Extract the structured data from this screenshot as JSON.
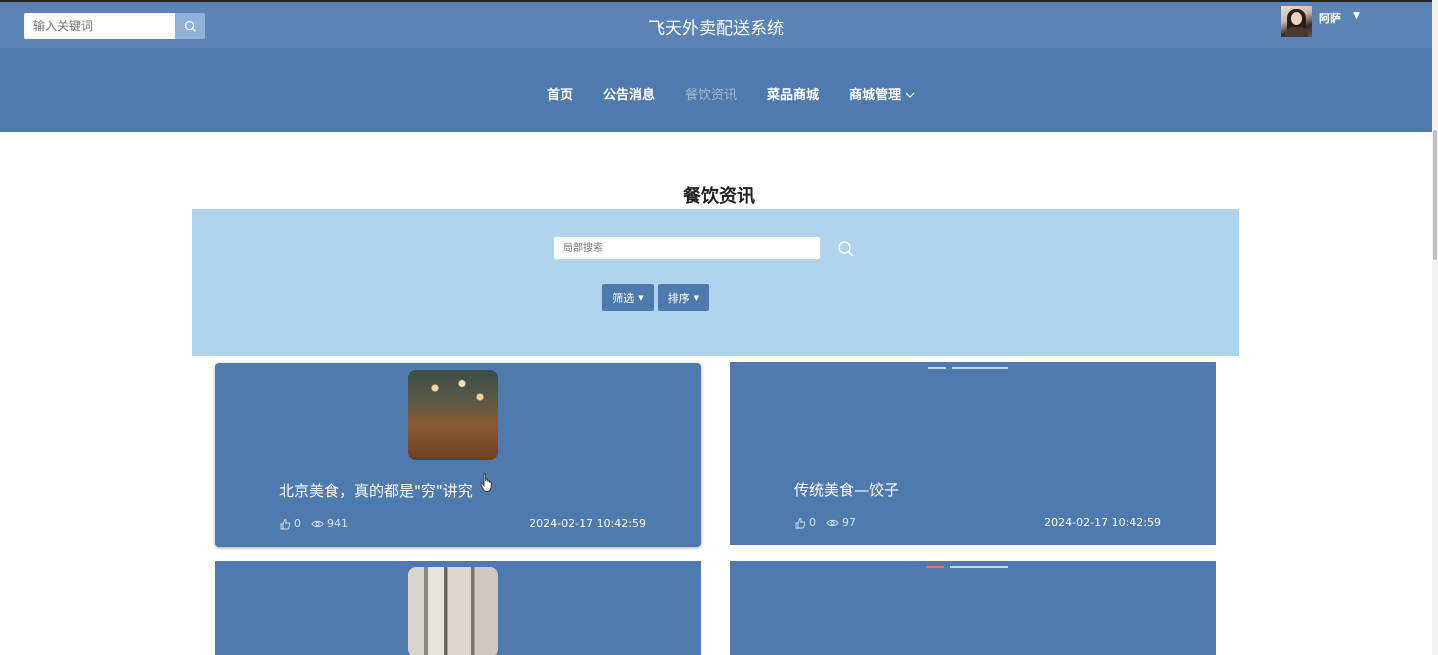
{
  "topbar": {
    "search_placeholder": "输入关键词",
    "site_title": "飞天外卖配送系统",
    "user": {
      "name": "阿萨"
    }
  },
  "nav": {
    "items": [
      {
        "label": "首页"
      },
      {
        "label": "公告消息"
      },
      {
        "label": "餐饮资讯",
        "active": true
      },
      {
        "label": "菜品商城"
      },
      {
        "label": "商城管理"
      }
    ]
  },
  "main": {
    "page_title": "餐饮资讯",
    "local_search_placeholder": "局部搜索",
    "filter_label": "筛选",
    "sort_label": "排序"
  },
  "cards": [
    {
      "title": "北京美食，真的都是\"穷\"讲究",
      "likes": "0",
      "views": "941",
      "date": "2024-02-17 10:42:59"
    },
    {
      "title": "传统美食—饺子",
      "likes": "0",
      "views": "97",
      "date": "2024-02-17 10:42:59"
    }
  ],
  "colors": {
    "topbar": "#5b83b5",
    "navbar": "#4f7aae",
    "panel": "#b0d3ed",
    "card": "#4f7aae"
  },
  "icons": {
    "search": "search-icon",
    "like": "thumb-up-icon",
    "views": "eye-icon",
    "dropdown": "chevron-down-icon"
  }
}
